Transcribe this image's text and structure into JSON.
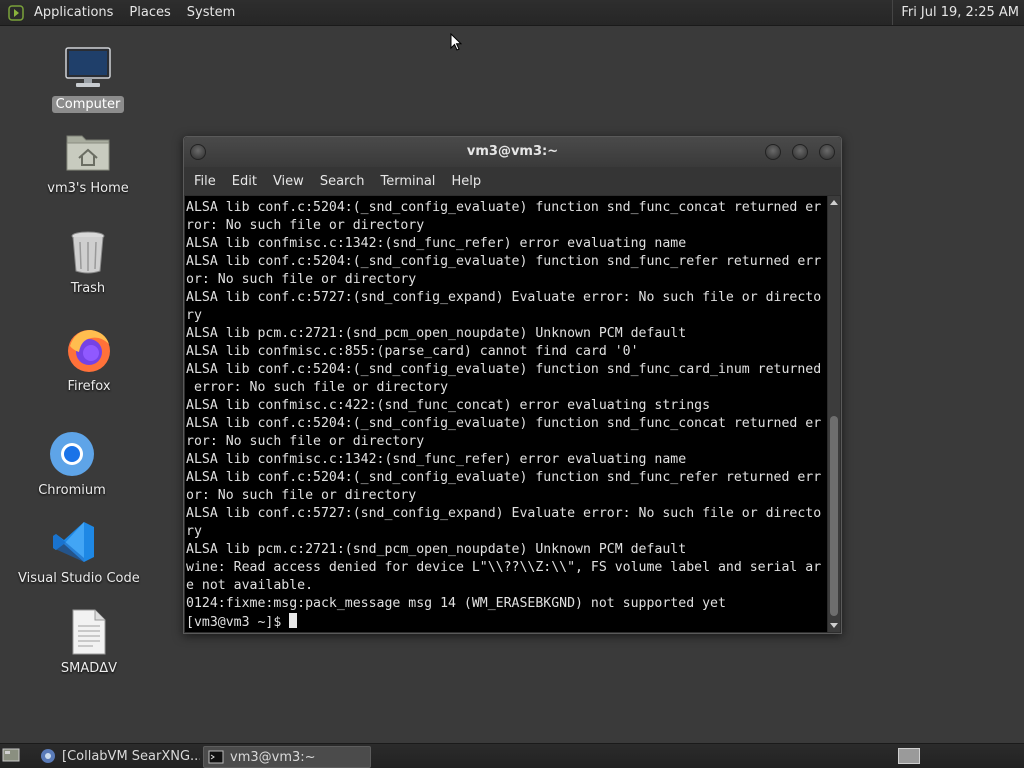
{
  "top_panel": {
    "menu": [
      "Applications",
      "Places",
      "System"
    ],
    "clock": "Fri Jul 19,  2:25 AM"
  },
  "desktop_icons": [
    {
      "label": "Computer",
      "icon": "computer-icon",
      "selected": true
    },
    {
      "label": "vm3's Home",
      "icon": "home-folder-icon"
    },
    {
      "label": "Trash",
      "icon": "trash-icon"
    },
    {
      "label": "Firefox",
      "icon": "firefox-icon"
    },
    {
      "label": "Chromium",
      "icon": "chromium-icon"
    },
    {
      "label": "Visual Studio Code",
      "icon": "vscode-icon"
    },
    {
      "label": "SMADΔV",
      "icon": "document-icon"
    }
  ],
  "terminal": {
    "title": "vm3@vm3:~",
    "menu": [
      "File",
      "Edit",
      "View",
      "Search",
      "Terminal",
      "Help"
    ],
    "lines": [
      "ALSA lib conf.c:5204:(_snd_config_evaluate) function snd_func_concat returned er",
      "ror: No such file or directory",
      "ALSA lib confmisc.c:1342:(snd_func_refer) error evaluating name",
      "ALSA lib conf.c:5204:(_snd_config_evaluate) function snd_func_refer returned err",
      "or: No such file or directory",
      "ALSA lib conf.c:5727:(snd_config_expand) Evaluate error: No such file or directo",
      "ry",
      "ALSA lib pcm.c:2721:(snd_pcm_open_noupdate) Unknown PCM default",
      "ALSA lib confmisc.c:855:(parse_card) cannot find card '0'",
      "ALSA lib conf.c:5204:(_snd_config_evaluate) function snd_func_card_inum returned",
      " error: No such file or directory",
      "ALSA lib confmisc.c:422:(snd_func_concat) error evaluating strings",
      "ALSA lib conf.c:5204:(_snd_config_evaluate) function snd_func_concat returned er",
      "ror: No such file or directory",
      "ALSA lib confmisc.c:1342:(snd_func_refer) error evaluating name",
      "ALSA lib conf.c:5204:(_snd_config_evaluate) function snd_func_refer returned err",
      "or: No such file or directory",
      "ALSA lib conf.c:5727:(snd_config_expand) Evaluate error: No such file or directo",
      "ry",
      "ALSA lib pcm.c:2721:(snd_pcm_open_noupdate) Unknown PCM default",
      "wine: Read access denied for device L\"\\\\??\\\\Z:\\\\\", FS volume label and serial ar",
      "e not available.",
      "0124:fixme:msg:pack_message msg 14 (WM_ERASEBKGND) not supported yet"
    ],
    "prompt": "[vm3@vm3 ~]$ "
  },
  "taskbar": {
    "tasks": [
      {
        "label": "[CollabVM SearXNG...",
        "icon": "browser-icon",
        "active": false
      },
      {
        "label": "vm3@vm3:~",
        "icon": "terminal-icon",
        "active": true
      }
    ]
  },
  "colors": {
    "desktop_bg": "#3a3a3a",
    "panel_bg": "#262626",
    "terminal_bg": "#000000",
    "terminal_fg": "#e0e0e0"
  }
}
